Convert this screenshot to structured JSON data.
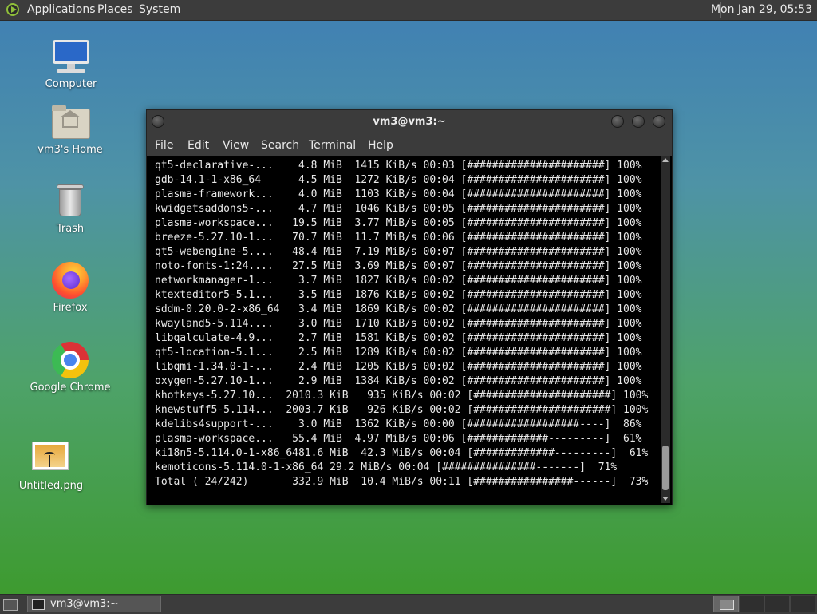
{
  "top_panel": {
    "applications": "Applications",
    "places": "Places",
    "system": "System",
    "clock": "Mon Jan 29, 05:53"
  },
  "desktop_icons": {
    "computer": "Computer",
    "home": "vm3's Home",
    "trash": "Trash",
    "firefox": "Firefox",
    "chrome": "Google Chrome",
    "untitled": "Untitled.png"
  },
  "terminal": {
    "title": "vm3@vm3:~",
    "menu": [
      "File",
      "Edit",
      "View",
      "Search",
      "Terminal",
      "Help"
    ],
    "lines": [
      "qt5-declarative-...    4.8 MiB  1415 KiB/s 00:03 [######################] 100%",
      "gdb-14.1-1-x86_64      4.5 MiB  1272 KiB/s 00:04 [######################] 100%",
      "plasma-framework...    4.0 MiB  1103 KiB/s 00:04 [######################] 100%",
      "kwidgetsaddons5-...    4.7 MiB  1046 KiB/s 00:05 [######################] 100%",
      "plasma-workspace...   19.5 MiB  3.77 MiB/s 00:05 [######################] 100%",
      "breeze-5.27.10-1...   70.7 MiB  11.7 MiB/s 00:06 [######################] 100%",
      "qt5-webengine-5....   48.4 MiB  7.19 MiB/s 00:07 [######################] 100%",
      "noto-fonts-1:24....   27.5 MiB  3.69 MiB/s 00:07 [######################] 100%",
      "networkmanager-1...    3.7 MiB  1827 KiB/s 00:02 [######################] 100%",
      "ktexteditor5-5.1...    3.5 MiB  1876 KiB/s 00:02 [######################] 100%",
      "sddm-0.20.0-2-x86_64   3.4 MiB  1869 KiB/s 00:02 [######################] 100%",
      "kwayland5-5.114....    3.0 MiB  1710 KiB/s 00:02 [######################] 100%",
      "libqalculate-4.9...    2.7 MiB  1581 KiB/s 00:02 [######################] 100%",
      "qt5-location-5.1...    2.5 MiB  1289 KiB/s 00:02 [######################] 100%",
      "libqmi-1.34.0-1-...    2.4 MiB  1205 KiB/s 00:02 [######################] 100%",
      "oxygen-5.27.10-1...    2.9 MiB  1384 KiB/s 00:02 [######################] 100%",
      "khotkeys-5.27.10...  2010.3 KiB   935 KiB/s 00:02 [######################] 100%",
      "knewstuff5-5.114...  2003.7 KiB   926 KiB/s 00:02 [######################] 100%",
      "kdelibs4support-...    3.0 MiB  1362 KiB/s 00:00 [##################----]  86%",
      "plasma-workspace...   55.4 MiB  4.97 MiB/s 00:06 [#############---------]  61%",
      "ki18n5-5.114.0-1-x86_6481.6 MiB  42.3 MiB/s 00:04 [#############---------]  61%",
      "kemoticons-5.114.0-1-x86_64 29.2 MiB/s 00:04 [###############-------]  71%",
      "Total ( 24/242)       332.9 MiB  10.4 MiB/s 00:11 [################------]  73%"
    ]
  },
  "taskbar": {
    "item": "vm3@vm3:~"
  }
}
